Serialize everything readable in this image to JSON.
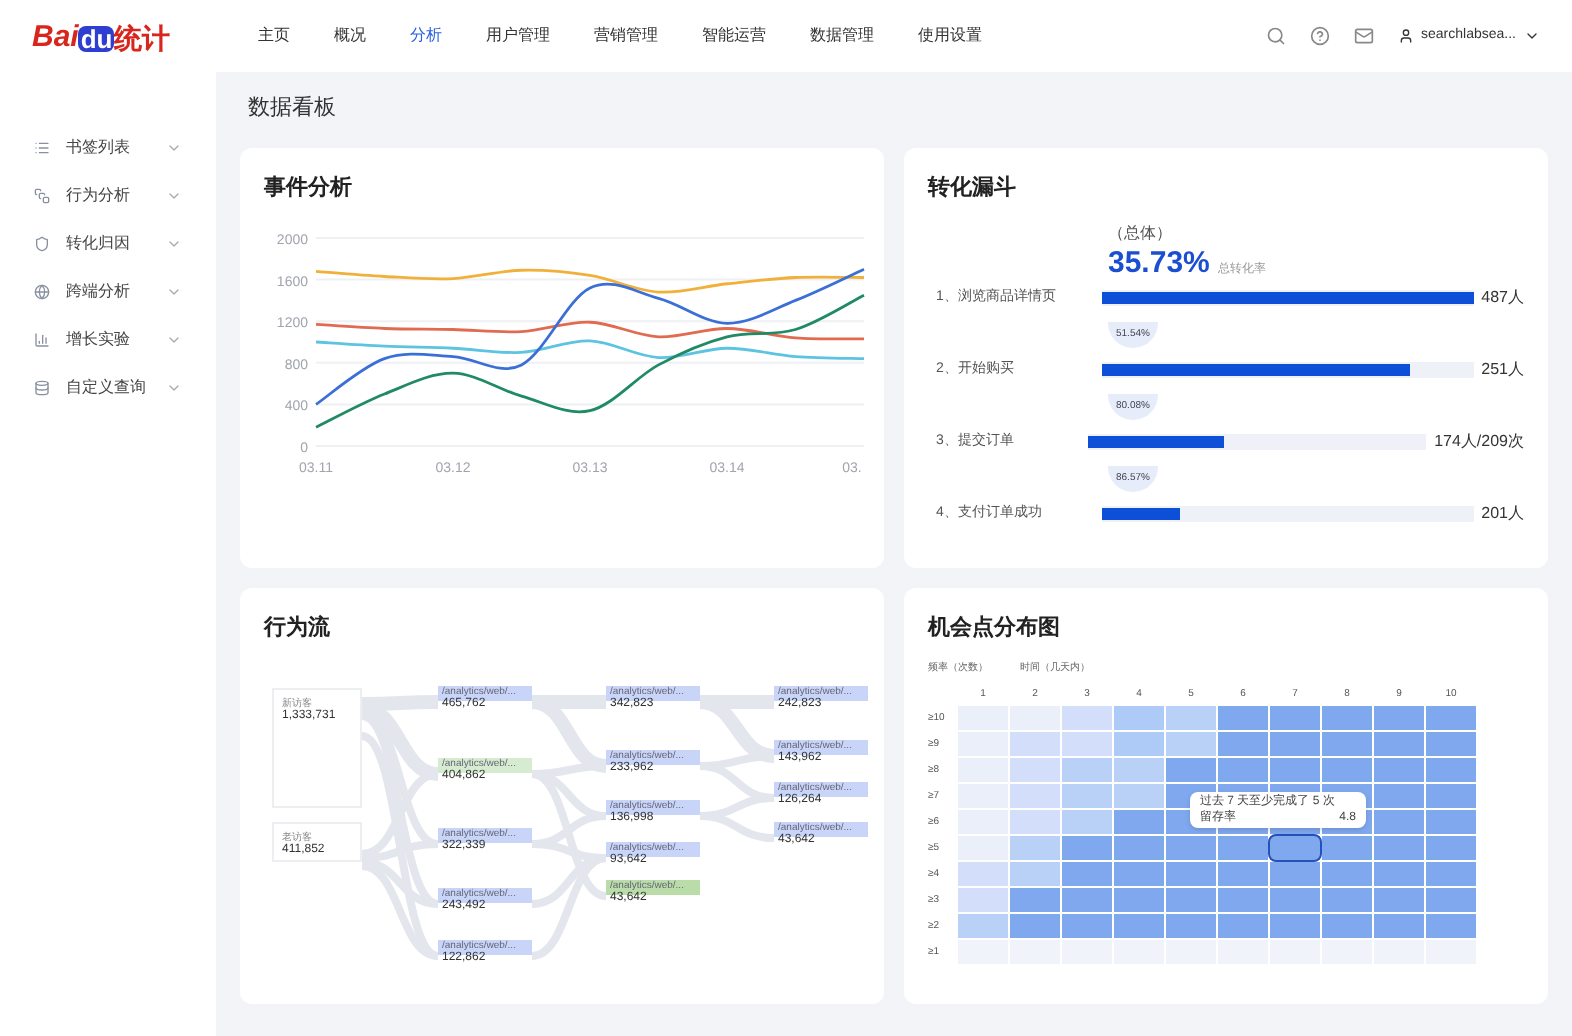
{
  "header": {
    "logo": {
      "latin": "Bai",
      "du": "du",
      "cjk": "统计"
    },
    "nav": [
      {
        "label": "主页",
        "selected": false
      },
      {
        "label": "概况",
        "selected": false
      },
      {
        "label": "分析",
        "selected": true
      },
      {
        "label": "用户管理",
        "selected": false
      },
      {
        "label": "营销管理",
        "selected": false
      },
      {
        "label": "智能运营",
        "selected": false
      },
      {
        "label": "数据管理",
        "selected": false
      },
      {
        "label": "使用设置",
        "selected": false
      }
    ],
    "user": "searchlabsea..."
  },
  "sidebar": {
    "items": [
      {
        "label": "书签列表",
        "kind": "list"
      },
      {
        "label": "行为分析",
        "kind": "box"
      },
      {
        "label": "转化归因",
        "kind": "shield"
      },
      {
        "label": "跨端分析",
        "kind": "globe"
      },
      {
        "label": "增长实验",
        "kind": "bars"
      },
      {
        "label": "自定义查询",
        "kind": "db"
      }
    ]
  },
  "page_title": "数据看板",
  "events": {
    "title": "事件分析",
    "chart_data": {
      "type": "line",
      "grid": true,
      "categories": [
        "03.11",
        null,
        "03.12",
        null,
        "03.13",
        null,
        "03.14",
        null,
        "03."
      ],
      "ylim": [
        0,
        2000
      ],
      "yticks": [
        0,
        400,
        800,
        1200,
        1600,
        2000
      ],
      "series": [
        {
          "color": "#f0b03a",
          "values": [
            1680,
            1630,
            1610,
            1690,
            1640,
            1480,
            1560,
            1620,
            1620
          ]
        },
        {
          "color": "#e06b50",
          "values": [
            1170,
            1130,
            1120,
            1100,
            1190,
            1050,
            1130,
            1040,
            1030
          ]
        },
        {
          "color": "#5cc4e0",
          "values": [
            1000,
            960,
            940,
            900,
            1010,
            850,
            940,
            860,
            840
          ]
        },
        {
          "color": "#3b6fd6",
          "values": [
            400,
            840,
            860,
            780,
            1520,
            1420,
            1180,
            1400,
            1700
          ]
        },
        {
          "color": "#1f8a64",
          "values": [
            180,
            500,
            700,
            480,
            340,
            780,
            1050,
            1120,
            1450
          ]
        }
      ]
    }
  },
  "funnel": {
    "title": "转化漏斗",
    "overall_label": "（总体）",
    "overall_value": "35.73%",
    "overall_caption": "总转化率",
    "steps": [
      {
        "label": "1、浏览商品详情页",
        "level": 1,
        "value": "487人"
      },
      {
        "label": "2、开始购买",
        "level": 0.83,
        "value": "251人"
      },
      {
        "label": "3、提交订单",
        "level": 0.4,
        "value": "174人/209次"
      },
      {
        "label": "4、支付订单成功",
        "level": 0.21,
        "value": "201人"
      }
    ],
    "rates": [
      "51.54%",
      "80.08%",
      "86.57%"
    ]
  },
  "flow": {
    "title": "行为流",
    "sources": [
      {
        "label": "新访客",
        "value": "1,333,731"
      },
      {
        "label": "老访客",
        "value": "411,852"
      }
    ],
    "columns": [
      [
        {
          "label": "/analytics/web/...",
          "value": "465,762",
          "color": "#c8d5f8"
        },
        {
          "label": "/analytics/web/...",
          "value": "404,862",
          "color": "#d6ecd0"
        },
        {
          "label": "/analytics/web/...",
          "value": "322,339",
          "color": "#c8d5f8"
        },
        {
          "label": "/analytics/web/...",
          "value": "243,492",
          "color": "#c8d5f8"
        },
        {
          "label": "/analytics/web/...",
          "value": "122,862",
          "color": "#c8d5f8"
        }
      ],
      [
        {
          "label": "/analytics/web/...",
          "value": "342,823",
          "color": "#c8d5f8"
        },
        {
          "label": "/analytics/web/...",
          "value": "233,962",
          "color": "#c8d5f8"
        },
        {
          "label": "/analytics/web/...",
          "value": "136,998",
          "color": "#c8d5f8"
        },
        {
          "label": "/analytics/web/...",
          "value": "93,642",
          "color": "#c8d5f8"
        },
        {
          "label": "/analytics/web/...",
          "value": "43,642",
          "color": "#b9dca9"
        }
      ],
      [
        {
          "label": "/analytics/web/...",
          "value": "242,823",
          "color": "#c8d5f8"
        },
        {
          "label": "/analytics/web/...",
          "value": "143,962",
          "color": "#c8d5f8"
        },
        {
          "label": "/analytics/web/...",
          "value": "126,264",
          "color": "#c8d5f8"
        },
        {
          "label": "/analytics/web/...",
          "value": "43,642",
          "color": "#c8d5f8"
        }
      ]
    ]
  },
  "heatmap": {
    "title": "机会点分布图",
    "axis_labels": [
      "频率（次数）",
      "时间（几天内）"
    ],
    "columns": [
      "1",
      "2",
      "3",
      "4",
      "5",
      "6",
      "7",
      "8",
      "9",
      "10"
    ],
    "rows": [
      {
        "label": "≥10",
        "cells": [
          {
            "color": "#eaeffa"
          },
          {
            "color": "#eaeffa"
          },
          {
            "color": "#d3defa"
          },
          {
            "color": "#aecaf6"
          },
          {
            "color": "#b9d1f7"
          },
          {
            "color": "#7fa8ef"
          },
          {
            "color": "#7fa8ef"
          },
          {
            "color": "#7fa8ef"
          },
          {
            "color": "#7fa8ef"
          },
          {
            "color": "#7fa8ef"
          }
        ]
      },
      {
        "label": "≥9",
        "cells": [
          {
            "color": "#eaeffa"
          },
          {
            "color": "#d3defa"
          },
          {
            "color": "#d3defa"
          },
          {
            "color": "#aecaf6"
          },
          {
            "color": "#b9d1f7"
          },
          {
            "color": "#7fa8ef"
          },
          {
            "color": "#7fa8ef"
          },
          {
            "color": "#7fa8ef"
          },
          {
            "color": "#7fa8ef"
          },
          {
            "color": "#7fa8ef"
          }
        ]
      },
      {
        "label": "≥8",
        "cells": [
          {
            "color": "#eaeffa"
          },
          {
            "color": "#d3defa"
          },
          {
            "color": "#b9d1f7"
          },
          {
            "color": "#b9d1f7"
          },
          {
            "color": "#7fa8ef"
          },
          {
            "color": "#7fa8ef"
          },
          {
            "color": "#7fa8ef"
          },
          {
            "color": "#7fa8ef"
          },
          {
            "color": "#7fa8ef"
          },
          {
            "color": "#7fa8ef"
          }
        ]
      },
      {
        "label": "≥7",
        "cells": [
          {
            "color": "#eaeffa"
          },
          {
            "color": "#d3defa"
          },
          {
            "color": "#b9d1f7"
          },
          {
            "color": "#b9d1f7"
          },
          {
            "color": "#7fa8ef"
          },
          {
            "color": "#7fa8ef"
          },
          {
            "color": "#7fa8ef"
          },
          {
            "color": "#7fa8ef"
          },
          {
            "color": "#7fa8ef"
          },
          {
            "color": "#7fa8ef"
          }
        ]
      },
      {
        "label": "≥6",
        "cells": [
          {
            "color": "#eaeffa"
          },
          {
            "color": "#d3defa"
          },
          {
            "color": "#b9d1f7"
          },
          {
            "color": "#7fa8ef"
          },
          {
            "color": "#7fa8ef"
          },
          {
            "color": "#7fa8ef"
          },
          {
            "color": "#7fa8ef"
          },
          {
            "color": "#7fa8ef"
          },
          {
            "color": "#7fa8ef"
          },
          {
            "color": "#7fa8ef"
          }
        ]
      },
      {
        "label": "≥5",
        "cells": [
          {
            "color": "#eaeffa"
          },
          {
            "color": "#b9d1f7"
          },
          {
            "color": "#7fa8ef"
          },
          {
            "color": "#7fa8ef"
          },
          {
            "color": "#7fa8ef"
          },
          {
            "color": "#7fa8ef"
          },
          {
            "color": "#7fa8ef"
          },
          {
            "color": "#7fa8ef"
          },
          {
            "color": "#7fa8ef"
          },
          {
            "color": "#7fa8ef"
          }
        ]
      },
      {
        "label": "≥4",
        "cells": [
          {
            "color": "#d3defa"
          },
          {
            "color": "#b9d1f7"
          },
          {
            "color": "#7fa8ef"
          },
          {
            "color": "#7fa8ef"
          },
          {
            "color": "#7fa8ef"
          },
          {
            "color": "#7fa8ef"
          },
          {
            "color": "#7fa8ef"
          },
          {
            "color": "#7fa8ef"
          },
          {
            "color": "#7fa8ef"
          },
          {
            "color": "#7fa8ef"
          }
        ]
      },
      {
        "label": "≥3",
        "cells": [
          {
            "color": "#d3defa"
          },
          {
            "color": "#7fa8ef"
          },
          {
            "color": "#7fa8ef"
          },
          {
            "color": "#7fa8ef"
          },
          {
            "color": "#7fa8ef"
          },
          {
            "color": "#7fa8ef"
          },
          {
            "color": "#7fa8ef"
          },
          {
            "color": "#7fa8ef"
          },
          {
            "color": "#7fa8ef"
          },
          {
            "color": "#7fa8ef"
          }
        ]
      },
      {
        "label": "≥2",
        "cells": [
          {
            "color": "#b9d1f7"
          },
          {
            "color": "#7fa8ef"
          },
          {
            "color": "#7fa8ef"
          },
          {
            "color": "#7fa8ef"
          },
          {
            "color": "#7fa8ef"
          },
          {
            "color": "#7fa8ef"
          },
          {
            "color": "#7fa8ef"
          },
          {
            "color": "#7fa8ef"
          },
          {
            "color": "#7fa8ef"
          },
          {
            "color": "#7fa8ef"
          }
        ]
      },
      {
        "label": "≥1",
        "cells": [
          {
            "color": "#f0f3fa"
          },
          {
            "color": "#f0f3fa"
          },
          {
            "color": "#f0f3fa"
          },
          {
            "color": "#f0f3fa"
          },
          {
            "color": "#f0f3fa"
          },
          {
            "color": "#f0f3fa"
          },
          {
            "color": "#f0f3fa"
          },
          {
            "color": "#f0f3fa"
          },
          {
            "color": "#f0f3fa"
          },
          {
            "color": "#f0f3fa"
          }
        ]
      }
    ],
    "tooltip": {
      "line": "过去 7 天至少完成了 5 次",
      "metric": "留存率",
      "value": "4.8"
    }
  }
}
